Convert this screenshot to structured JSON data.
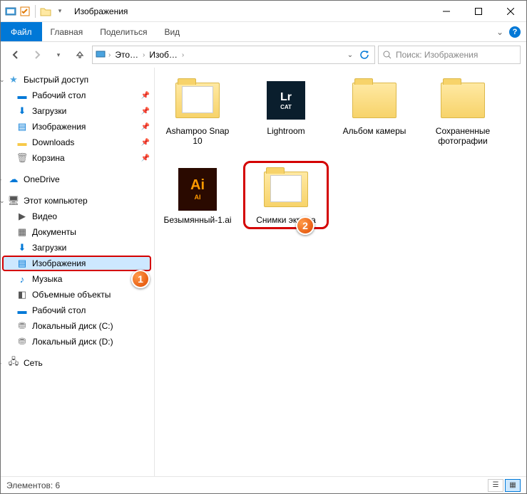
{
  "window": {
    "title": "Изображения"
  },
  "ribbon": {
    "file": "Файл",
    "tabs": [
      "Главная",
      "Поделиться",
      "Вид"
    ]
  },
  "breadcrumbs": [
    "Это…",
    "Изоб…"
  ],
  "search_placeholder": "Поиск: Изображения",
  "sidebar": {
    "quick_access": {
      "label": "Быстрый доступ",
      "items": [
        {
          "label": "Рабочий стол",
          "pinned": true
        },
        {
          "label": "Загрузки",
          "pinned": true
        },
        {
          "label": "Изображения",
          "pinned": true
        },
        {
          "label": "Downloads",
          "pinned": true
        },
        {
          "label": "Корзина",
          "pinned": true
        }
      ]
    },
    "onedrive": {
      "label": "OneDrive"
    },
    "this_pc": {
      "label": "Этот компьютер",
      "items": [
        {
          "label": "Видео"
        },
        {
          "label": "Документы"
        },
        {
          "label": "Загрузки"
        },
        {
          "label": "Изображения",
          "highlighted": true
        },
        {
          "label": "Музыка"
        },
        {
          "label": "Объемные объекты"
        },
        {
          "label": "Рабочий стол"
        },
        {
          "label": "Локальный диск (C:)"
        },
        {
          "label": "Локальный диск (D:)"
        }
      ]
    },
    "network": {
      "label": "Сеть"
    }
  },
  "items": [
    {
      "name": "Ashampoo Snap 10",
      "type": "folder_preview"
    },
    {
      "name": "Lightroom",
      "type": "lr"
    },
    {
      "name": "Альбом камеры",
      "type": "folder"
    },
    {
      "name": "Сохраненные фотографии",
      "type": "folder"
    },
    {
      "name": "Безымянный-1.ai",
      "type": "ai"
    },
    {
      "name": "Снимки экрана",
      "type": "folder_preview",
      "highlighted": true,
      "callout": "2"
    }
  ],
  "callout_sidebar": "1",
  "status": {
    "count_label": "Элементов: 6"
  }
}
